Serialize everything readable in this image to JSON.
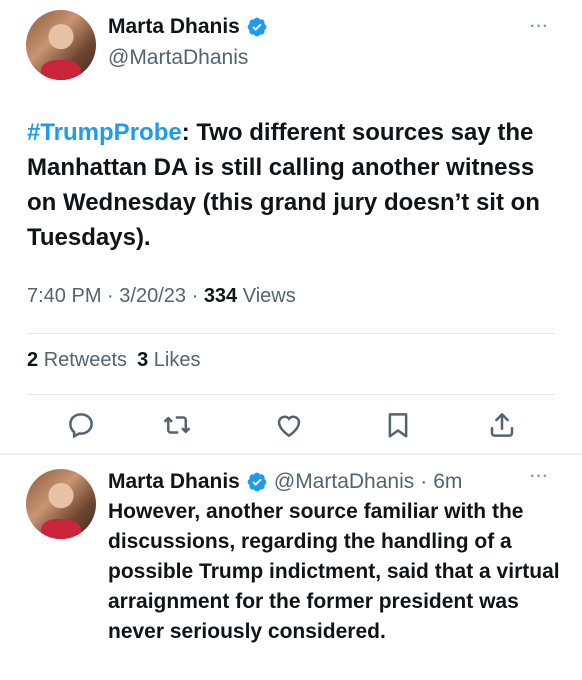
{
  "tweet": {
    "author_name": "Marta Dhanis",
    "author_handle": "@MartaDhanis",
    "more_label": "···",
    "hashtag": "#TrumpProbe",
    "text": ": Two different sources say the Manhattan DA is still calling another witness on Wednesday (this grand jury doesn’t sit on Tuesdays).",
    "time": "7:40 PM",
    "date": "3/20/23",
    "views_count": "334",
    "views_label": "Views",
    "separator": "·",
    "retweets_count": "2",
    "retweets_label": "Retweets",
    "likes_count": "3",
    "likes_label": "Likes"
  },
  "actions": [
    {
      "icon": "reply-icon"
    },
    {
      "icon": "retweet-icon"
    },
    {
      "icon": "like-icon"
    },
    {
      "icon": "bookmark-icon"
    },
    {
      "icon": "share-icon"
    }
  ],
  "reply": {
    "author_name": "Marta Dhanis",
    "author_handle": "@MartaDhanis",
    "separator": "·",
    "age": "6m",
    "more_label": "···",
    "text": "However, another source familiar with the discussions, regarding the handling of a possible Trump indictment, said that a virtual arraignment for the former president was never seriously considered."
  },
  "colors": {
    "accent": "#1d9bf0",
    "secondary_text": "#536471",
    "primary_text": "#0f1419",
    "divider": "#e7eaed"
  }
}
